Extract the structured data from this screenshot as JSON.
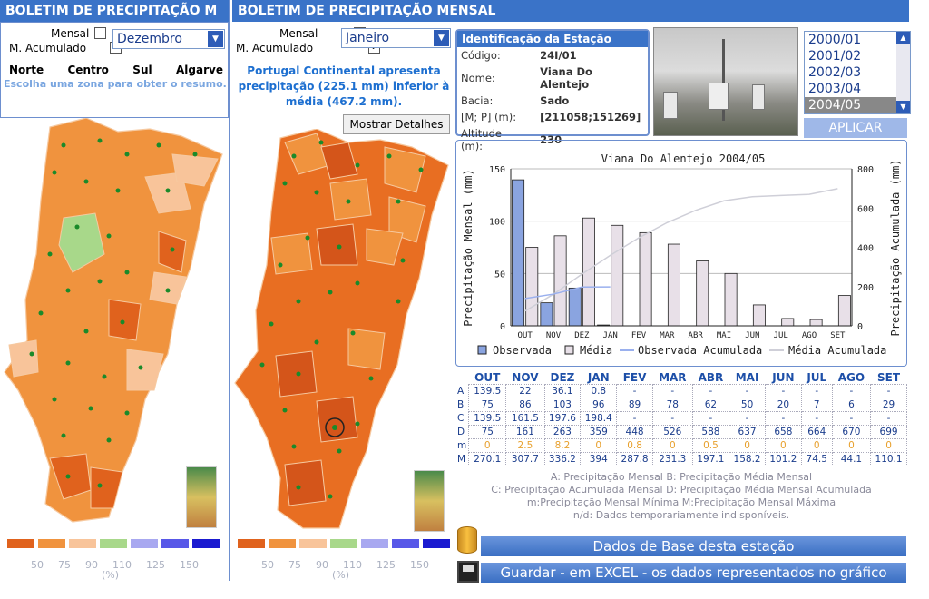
{
  "left_panel": {
    "title": "BOLETIM DE PRECIPITAÇÃO M",
    "mensal_label": "Mensal",
    "acumulado_label": "M. Acumulado",
    "month_value": "Dezembro",
    "zones": [
      "Norte",
      "Centro",
      "Sul",
      "Algarve"
    ],
    "hint": "Escolha uma zona para obter o resumo."
  },
  "mid_panel": {
    "title": "BOLETIM DE PRECIPITAÇÃO MENSAL",
    "mensal_label": "Mensal",
    "acumulado_label": "M. Acumulado",
    "month_value": "Janeiro",
    "summary": "Portugal Continental apresenta precipitação (225.1 mm) inferior à média (467.2 mm).",
    "details_button": "Mostrar Detalhes"
  },
  "scale": {
    "colors": [
      "#e0621d",
      "#f0933e",
      "#f8c49a",
      "#a8d88a",
      "#a8a8f0",
      "#5858e8",
      "#1a1ad0"
    ],
    "labels": [
      "50",
      "75",
      "90",
      "110",
      "125",
      "150"
    ],
    "unit": "(%)"
  },
  "station": {
    "header": "Identificação da Estação",
    "rows": [
      {
        "k": "Código:",
        "v": "24I/01"
      },
      {
        "k": "Nome:",
        "v": "Viana Do Alentejo"
      },
      {
        "k": "Bacia:",
        "v": "Sado"
      },
      {
        "k": "[M; P] (m):",
        "v": "[211058;151269]"
      },
      {
        "k": "Altitude (m):",
        "v": "230"
      }
    ]
  },
  "years": {
    "items": [
      "2000/01",
      "2001/02",
      "2002/03",
      "2003/04",
      "2004/05"
    ],
    "selected": "2004/05",
    "apply_label": "APLICAR"
  },
  "chart_data": {
    "type": "bar",
    "title": "Viana Do Alentejo 2004/05",
    "ylabel": "Precipitação Mensal (mm)",
    "y2label": "Precipitação Acumulada (mm)",
    "categories": [
      "OUT",
      "NOV",
      "DEZ",
      "JAN",
      "FEV",
      "MAR",
      "ABR",
      "MAI",
      "JUN",
      "JUL",
      "AGO",
      "SET"
    ],
    "ylim": [
      0,
      150
    ],
    "yticks": [
      0,
      50,
      100,
      150
    ],
    "y2lim": [
      0,
      800
    ],
    "y2ticks": [
      0,
      200,
      400,
      600,
      800
    ],
    "series": [
      {
        "name": "Observada",
        "values": [
          139.5,
          22,
          36.1,
          0.8,
          null,
          null,
          null,
          null,
          null,
          null,
          null,
          null
        ]
      },
      {
        "name": "Média",
        "values": [
          75,
          86,
          103,
          96,
          89,
          78,
          62,
          50,
          20,
          7,
          6,
          29
        ]
      },
      {
        "name": "Observada Acumulada",
        "values": [
          139.5,
          161.5,
          197.6,
          198.4,
          null,
          null,
          null,
          null,
          null,
          null,
          null,
          null
        ]
      },
      {
        "name": "Média Acumulada",
        "values": [
          75,
          161,
          263,
          359,
          448,
          526,
          588,
          637,
          658,
          664,
          670,
          699
        ]
      }
    ],
    "colors": {
      "observada": "#8aa4e0",
      "media": "#e8e0e8",
      "obs_acum": "#9ab0ee",
      "media_acum": "#cfcfd8"
    },
    "grid": true
  },
  "table": {
    "months": [
      "OUT",
      "NOV",
      "DEZ",
      "JAN",
      "FEV",
      "MAR",
      "ABR",
      "MAI",
      "JUN",
      "JUL",
      "AGO",
      "SET"
    ],
    "rows": [
      {
        "label": "A",
        "cells": [
          "139.5",
          "22",
          "36.1",
          "0.8",
          "-",
          "-",
          "-",
          "-",
          "-",
          "-",
          "-",
          "-"
        ]
      },
      {
        "label": "B",
        "cells": [
          "75",
          "86",
          "103",
          "96",
          "89",
          "78",
          "62",
          "50",
          "20",
          "7",
          "6",
          "29"
        ]
      },
      {
        "label": "C",
        "cells": [
          "139.5",
          "161.5",
          "197.6",
          "198.4",
          "-",
          "-",
          "-",
          "-",
          "-",
          "-",
          "-",
          "-"
        ]
      },
      {
        "label": "D",
        "cells": [
          "75",
          "161",
          "263",
          "359",
          "448",
          "526",
          "588",
          "637",
          "658",
          "664",
          "670",
          "699"
        ]
      },
      {
        "label": "m",
        "cells": [
          "0",
          "2.5",
          "8.2",
          "0",
          "0.8",
          "0",
          "0.5",
          "0",
          "0",
          "0",
          "0",
          "0"
        ]
      },
      {
        "label": "M",
        "cells": [
          "270.1",
          "307.7",
          "336.2",
          "394",
          "287.8",
          "231.3",
          "197.1",
          "158.2",
          "101.2",
          "74.5",
          "44.1",
          "110.1"
        ]
      }
    ],
    "notes": [
      "A: Precipitação Mensal B: Precipitação Média Mensal",
      "C: Precipitação Acumulada Mensal D: Precipitação Média Mensal Acumulada",
      "m:Precipitação Mensal Mínima M:Precipitação Mensal Máxima",
      "n/d: Dados temporariamente indisponíveis."
    ]
  },
  "buttons": {
    "base_data": "Dados de Base desta estação",
    "excel": "Guardar - em EXCEL - os dados representados no gráfico"
  }
}
